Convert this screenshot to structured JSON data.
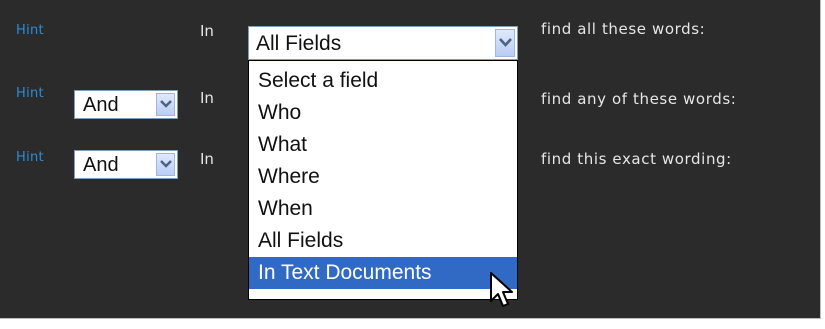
{
  "rows": [
    {
      "hint": "Hint",
      "in_label": "In",
      "phrase": "find all these words:"
    },
    {
      "hint": "Hint",
      "operator": "And",
      "in_label": "In",
      "phrase": "find any of these words:"
    },
    {
      "hint": "Hint",
      "operator": "And",
      "in_label": "In",
      "phrase": "find this exact wording:"
    }
  ],
  "field_select": {
    "value": "All Fields",
    "options": [
      "Select a field",
      "Who",
      "What",
      "Where",
      "When",
      "All Fields",
      "In Text Documents"
    ],
    "highlighted": "In Text Documents"
  },
  "icons": {
    "dropdown_arrow": "chevron-down-icon",
    "cursor": "mouse-pointer-icon"
  },
  "colors": {
    "background": "#2b2b2b",
    "hint_link": "#2d8ad6",
    "highlight": "#316ac5"
  }
}
